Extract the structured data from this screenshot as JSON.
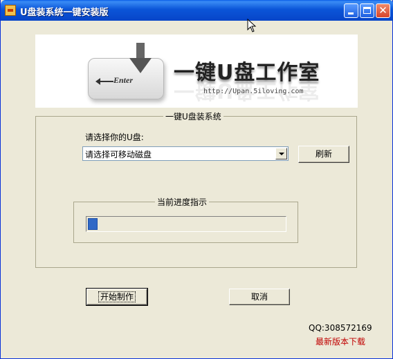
{
  "window": {
    "title": "U盘装系统一键安装版"
  },
  "banner": {
    "key_text": "Enter",
    "brand_text": "一键U盘工作室",
    "url": "http://Upan.5iloving.com"
  },
  "main_group": {
    "title": "一键U盘装系统",
    "drive_label": "请选择你的U盘:",
    "drive_select_value": "请选择可移动磁盘",
    "refresh_button": "刷新"
  },
  "progress": {
    "title": "当前进度指示",
    "value_percent": 5
  },
  "actions": {
    "start_button": "开始制作",
    "cancel_button": "取消"
  },
  "footer": {
    "qq": "QQ:308572169",
    "download_link": "最新版本下载"
  },
  "colors": {
    "title_bar": "#0b55d8",
    "progress_fill": "#3169c6",
    "link": "#c00000"
  }
}
